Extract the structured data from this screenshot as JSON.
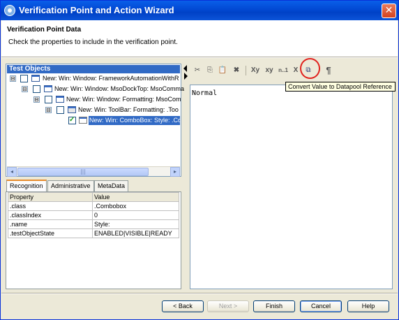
{
  "window": {
    "title": "Verification Point and Action Wizard",
    "close_glyph": "✕"
  },
  "header": {
    "title": "Verification Point Data",
    "subtitle": "Check the properties to include in the verification point."
  },
  "tree": {
    "header": "Test Objects",
    "items": [
      {
        "label": "New: Win: Window: FrameworkAutomationWithR",
        "expander": "⊟",
        "checked": false,
        "icon": "window-icon"
      },
      {
        "label": "New: Win: Window: MsoDockTop: MsoComma",
        "expander": "⊟",
        "checked": false,
        "icon": "window-icon"
      },
      {
        "label": "New: Win: Window: Formatting: MsoCom",
        "expander": "⊟",
        "checked": false,
        "icon": "window-icon"
      },
      {
        "label": "New: Win: ToolBar: Formatting: .Too",
        "expander": "⊟",
        "checked": false,
        "icon": "toolbar-icon"
      },
      {
        "label": "New: Win: ComboBox: Style: .Co",
        "expander": "",
        "checked": true,
        "icon": "combobox-icon"
      }
    ],
    "scroll_left": "◂",
    "scroll_right": "▸",
    "thumb_grip": "|||"
  },
  "tabs": [
    "Recognition",
    "Administrative",
    "MetaData"
  ],
  "properties": {
    "headers": [
      "Property",
      "Value"
    ],
    "rows": [
      [
        ".class",
        ".Combobox"
      ],
      [
        ".classIndex",
        "0"
      ],
      [
        ".name",
        "Style:"
      ],
      [
        ".testObjectState",
        "ENABLED|VISIBLE|READY"
      ]
    ]
  },
  "toolbar": {
    "buttons": [
      "✂",
      "⎘",
      "📋",
      "✖",
      "Xy",
      "xy",
      "n..1",
      "X",
      "⧉",
      "¶"
    ],
    "tooltip": "Convert Value to Datapool Reference"
  },
  "editor": {
    "value": "Normal"
  },
  "buttons": {
    "back": "< Back",
    "next": "Next >",
    "finish": "Finish",
    "cancel": "Cancel",
    "help": "Help"
  },
  "colors": {
    "titlebar": "#0249d3",
    "selection": "#316ac5",
    "highlight_circle": "#e0221e",
    "tooltip_bg": "#ffffe1"
  }
}
